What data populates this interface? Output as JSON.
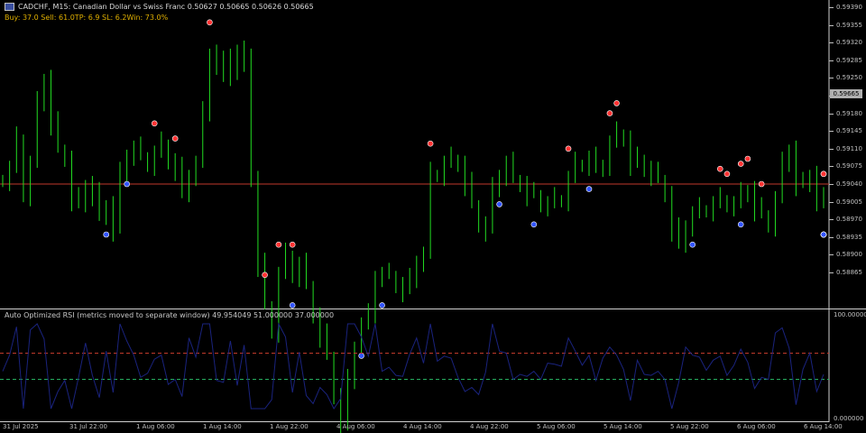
{
  "header": {
    "symbol_line": "CADCHF, M15:  Canadian Dollar vs Swiss Franc  0.50627 0.50665 0.50626 0.50665",
    "stats_line": "Buy: 37.0  Sell: 61.0TP: 6.9  SL: 6.2Win: 73.0%"
  },
  "subwindow": {
    "title": "Auto Optimized RSI (metrics moved to separate window) 49.954049 51.000000 37.000000",
    "scale_top": "100.000000",
    "scale_bottom": "0.000000"
  },
  "price_axis": {
    "ticks": [
      "0.59390",
      "0.59355",
      "0.59320",
      "0.59285",
      "0.59250",
      "0.59215",
      "0.59180",
      "0.59145",
      "0.59110",
      "0.59075",
      "0.59040",
      "0.59005",
      "0.58970",
      "0.58935",
      "0.58900",
      "0.58865"
    ],
    "current_price": "0.59665"
  },
  "time_axis": {
    "ticks": [
      "31 Jul 2025",
      "31 Jul 22:00",
      "1 Aug 06:00",
      "1 Aug 14:00",
      "1 Aug 22:00",
      "4 Aug 06:00",
      "4 Aug 14:00",
      "4 Aug 22:00",
      "5 Aug 06:00",
      "5 Aug 14:00",
      "5 Aug 22:00",
      "6 Aug 06:00",
      "6 Aug 14:00"
    ]
  },
  "colors": {
    "background": "#000000",
    "candles": "#22dd22",
    "hline": "#c0392b",
    "buy_arrow": "#3355ff",
    "sell_arrow": "#ff3333",
    "rsi_line": "#1a237e",
    "rsi_upper": "#c0392b",
    "rsi_lower": "#27ae60",
    "separator": "#d0d0d0"
  },
  "chart_data": {
    "type": "candlestick",
    "symbol": "CADCHF",
    "timeframe": "M15",
    "closes": [
      0.5905,
      0.5907,
      0.5913,
      0.5902,
      0.5908,
      0.592,
      0.5925,
      0.5916,
      0.5911,
      0.5909,
      0.5901,
      0.59,
      0.5904,
      0.5902,
      0.58975,
      0.59,
      0.5895,
      0.5906,
      0.591,
      0.5911,
      0.59095,
      0.5908,
      0.591,
      0.5912,
      0.59085,
      0.5907,
      0.5902,
      0.5906,
      0.5908,
      0.5918,
      0.593,
      0.5928,
      0.5925,
      0.593,
      0.5927,
      0.593,
      0.5905,
      0.5888,
      0.588,
      0.5875,
      0.5886,
      0.589,
      0.5886,
      0.5888,
      0.5884,
      0.5878,
      0.5874,
      0.587,
      0.5862,
      0.5856,
      0.5865,
      0.5872,
      0.5876,
      0.5878,
      0.5886,
      0.5886,
      0.5886,
      0.5884,
      0.5883,
      0.5885,
      0.5889,
      0.589,
      0.5906,
      0.5906,
      0.5908,
      0.5909,
      0.5908,
      0.5904,
      0.59,
      0.5896,
      0.5895,
      0.5903,
      0.5906,
      0.5908,
      0.5905,
      0.5904,
      0.5902,
      0.5902,
      0.59,
      0.59,
      0.5901,
      0.5901,
      0.5905,
      0.5908,
      0.5908,
      0.5909,
      0.5907,
      0.5908,
      0.5912,
      0.5914,
      0.5913,
      0.5908,
      0.5909,
      0.5907,
      0.5906,
      0.5905,
      0.5902,
      0.5895,
      0.5892,
      0.5896,
      0.5898,
      0.5899,
      0.5899,
      0.59,
      0.5901,
      0.59,
      0.59,
      0.5902,
      0.5903,
      0.5899,
      0.5898,
      0.5896,
      0.5901,
      0.5908,
      0.5911,
      0.5904,
      0.5904,
      0.5906,
      0.5901,
      0.59
    ],
    "buy_signal_indices": [
      15,
      18,
      42,
      52,
      55,
      72,
      77,
      85,
      100,
      107,
      121,
      122,
      136,
      138,
      140,
      141,
      155
    ],
    "sell_signal_indices": [
      22,
      25,
      30,
      38,
      40,
      42,
      62,
      82,
      88,
      89,
      104,
      105,
      107,
      108,
      110,
      126,
      152
    ],
    "horizontal_line_price": 0.5904,
    "indicator": {
      "name": "Auto Optimized RSI",
      "values": [
        49.954049,
        51.0,
        37.0
      ],
      "range": [
        0,
        100
      ],
      "upper_level": 63,
      "lower_level": 37
    }
  }
}
